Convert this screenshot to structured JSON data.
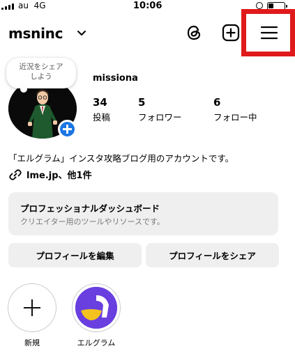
{
  "status_bar": {
    "carrier": "au",
    "network": "4G",
    "time": "10:06",
    "battery_level_percent": 35
  },
  "header": {
    "username": "msninc",
    "icons": [
      "chevron-down-icon",
      "threads-icon",
      "add-post-icon",
      "menu-icon"
    ],
    "highlight_color": "#e0191b"
  },
  "profile": {
    "note": "近況をシェア\nしよう",
    "display_name": "missiona",
    "stats": [
      {
        "value": "34",
        "label": "投稿"
      },
      {
        "value": "5",
        "label": "フォロワー"
      },
      {
        "value": "6",
        "label": "フォロー中"
      }
    ],
    "bio": "「エルグラム」インスタ攻略ブログ用のアカウントです。",
    "link": "lme.jp、他1件"
  },
  "dashboard": {
    "title": "プロフェッショナルダッシュボード",
    "subtitle": "クリエイター用のツールやリソースです。"
  },
  "buttons": {
    "edit_profile": "プロフィールを編集",
    "share_profile": "プロフィールをシェア"
  },
  "highlights": [
    {
      "label": "新規"
    },
    {
      "label": "エルグラム"
    }
  ],
  "colors": {
    "badge_blue": "#1b76e4",
    "button_gray": "#efefef",
    "elgram_purple": "#6a3fe0",
    "elgram_yellow": "#f4c21f"
  }
}
